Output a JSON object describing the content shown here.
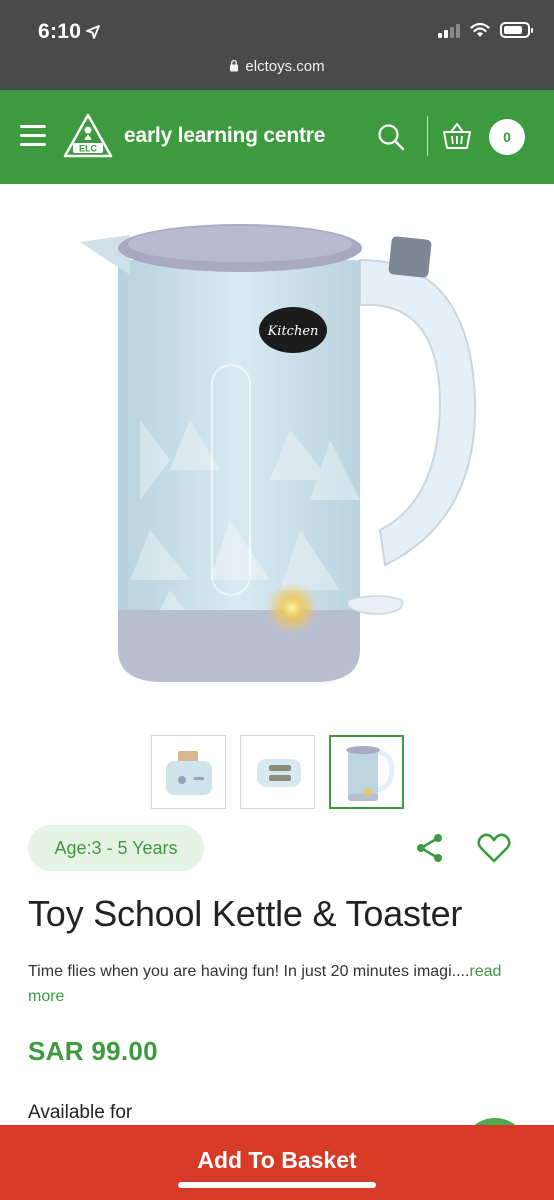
{
  "status_bar": {
    "time": "6:10",
    "url": "elctoys.com",
    "signal_bars": 2,
    "battery_level": 0.8
  },
  "header": {
    "brand": "early learning centre",
    "logo_text": "ELC",
    "basket_count": "0",
    "colors": {
      "brand_green": "#3d9a3f",
      "white": "#ffffff"
    }
  },
  "gallery": {
    "main_image": "kettle-toy-image",
    "kettle_badge_label": "Kitchen",
    "thumbnails": [
      {
        "name": "toaster",
        "selected": false
      },
      {
        "name": "toaster-top-view",
        "selected": false
      },
      {
        "name": "kettle",
        "selected": true
      }
    ]
  },
  "product": {
    "age": "Age:3 - 5 Years",
    "title": "Toy School Kettle & Toaster",
    "description": "Time flies when you are having fun! In just 20 minutes imagi....",
    "read_more": "read more",
    "price": "SAR 99.00",
    "availability_label": "Available for"
  },
  "actions": {
    "add_to_basket": "Add To Basket",
    "colors": {
      "cta_red": "#d83a28"
    }
  }
}
